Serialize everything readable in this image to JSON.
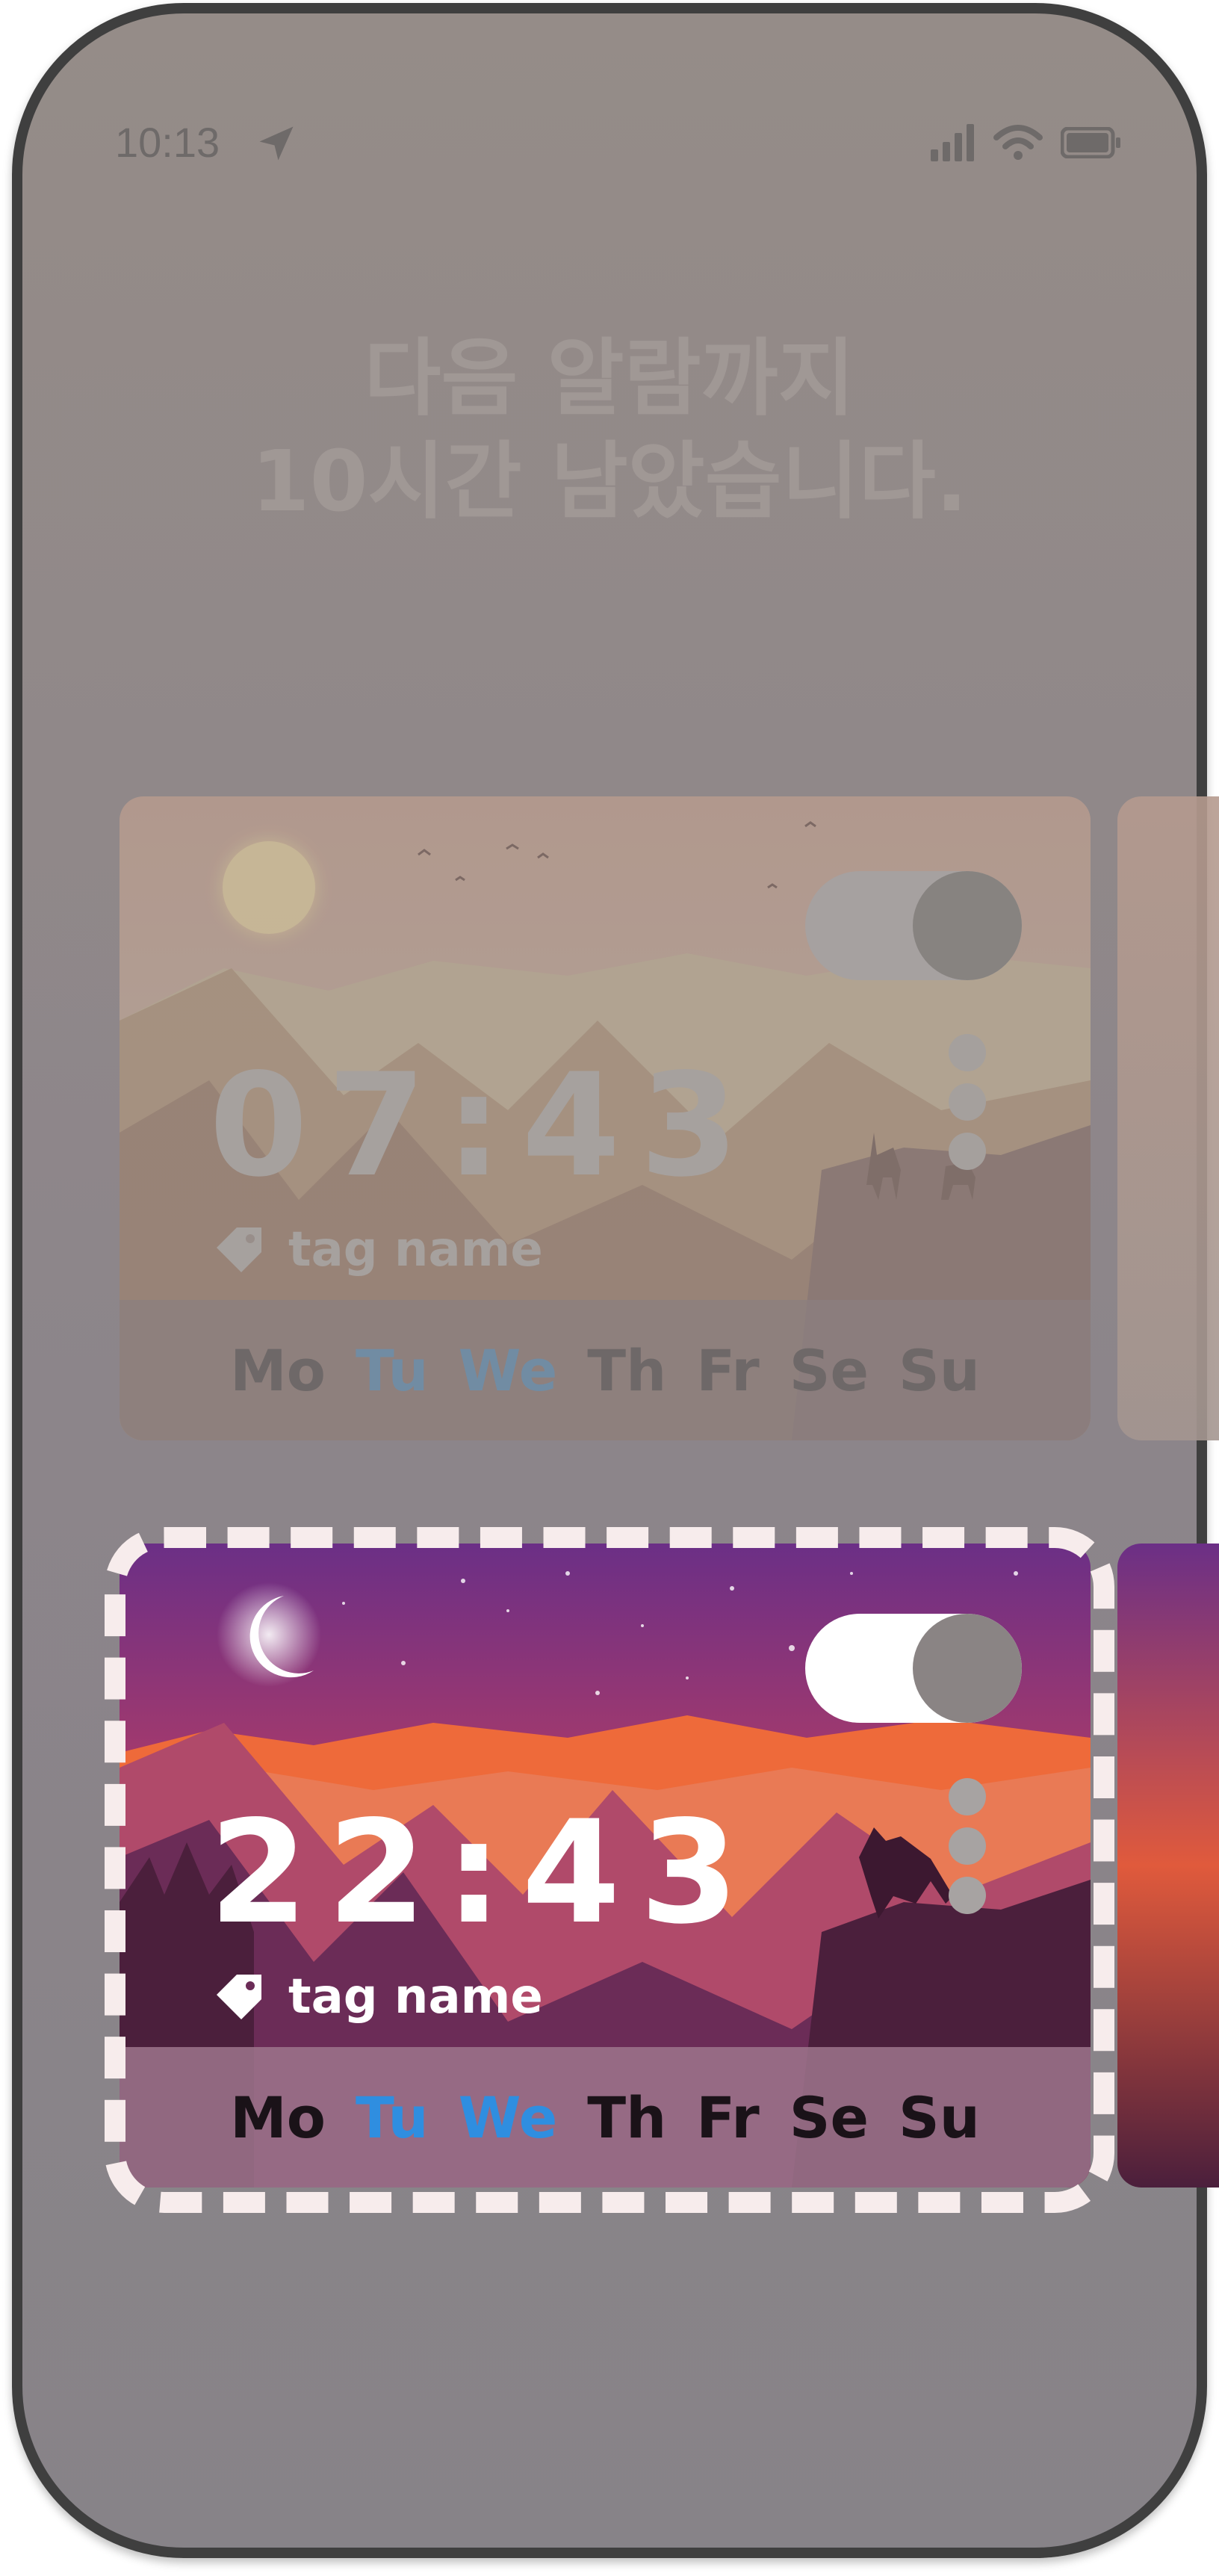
{
  "status_bar": {
    "time": "10:13",
    "icons": [
      "location-arrow-icon",
      "signal-icon",
      "wifi-icon",
      "battery-icon"
    ]
  },
  "headline": {
    "line1": "다음 알람까지",
    "line2": "10시간 남았습니다."
  },
  "alarms": [
    {
      "time": "07:43",
      "tag": "tag name",
      "enabled": false,
      "days": [
        "Mo",
        "Tu",
        "We",
        "Th",
        "Fr",
        "Se",
        "Su"
      ],
      "active_days": [
        "Tu",
        "We"
      ],
      "scene": "day-mountains-deer"
    },
    {
      "time": "22:43",
      "tag": "tag name",
      "enabled": true,
      "days": [
        "Mo",
        "Tu",
        "We",
        "Th",
        "Fr",
        "Se",
        "Su"
      ],
      "active_days": [
        "Tu",
        "We"
      ],
      "scene": "night-mountains-wolf"
    }
  ],
  "colors": {
    "active_day": "#2f8ee0",
    "frame": "#f7ecec",
    "night_sky_top": "#6b2f86",
    "night_sky_bottom": "#e05a3c"
  }
}
